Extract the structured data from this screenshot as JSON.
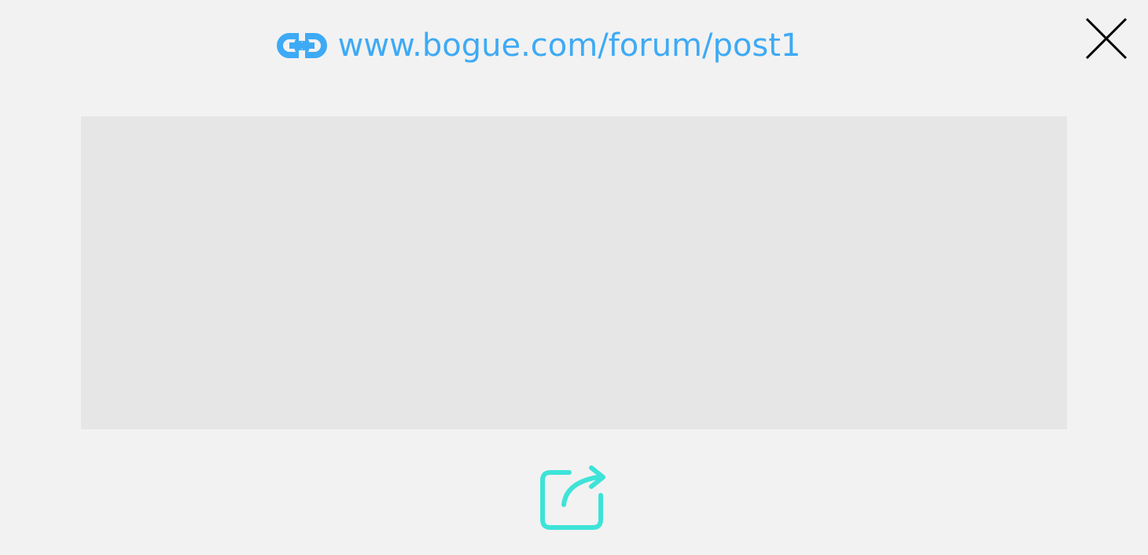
{
  "header": {
    "url_text": "www.bogue.com/forum/post1",
    "link_icon": "link-icon",
    "link_color": "#3eaaf5"
  },
  "controls": {
    "close_icon": "close-icon",
    "share_icon": "share-icon",
    "share_color": "#3ee3d8"
  },
  "preview": {
    "placeholder_color": "#e6e6e6"
  }
}
